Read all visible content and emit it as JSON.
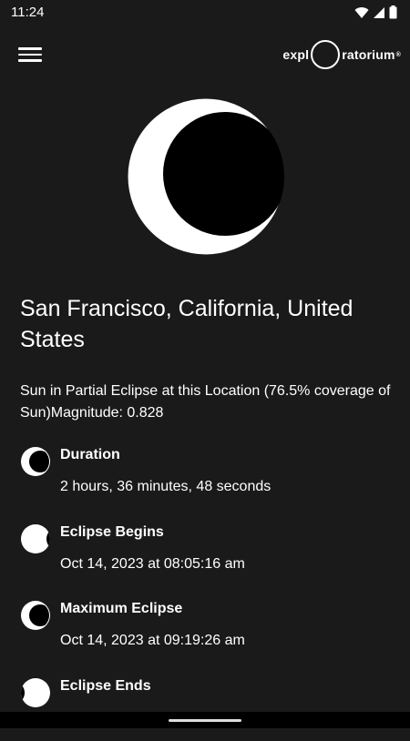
{
  "status_bar": {
    "time": "11:24"
  },
  "header": {
    "logo_left": "expl",
    "logo_right": "ratorium",
    "logo_mark": "®"
  },
  "location": {
    "title": "San Francisco, California, United States",
    "summary": "Sun in Partial Eclipse at this Location (76.5% coverage of Sun)Magnitude: 0.828"
  },
  "events": [
    {
      "label": "Duration",
      "value": "2 hours, 36 minutes, 48 seconds",
      "icon": "crescent-icon"
    },
    {
      "label": "Eclipse Begins",
      "value": "Oct 14, 2023 at 08:05:16 am",
      "icon": "eclipse-begin-icon"
    },
    {
      "label": "Maximum Eclipse",
      "value": "Oct 14, 2023 at 09:19:26 am",
      "icon": "crescent-icon"
    },
    {
      "label": "Eclipse Ends",
      "value": "",
      "icon": "eclipse-end-icon"
    }
  ],
  "colors": {
    "background": "#1a1a1a",
    "text": "#ffffff"
  }
}
